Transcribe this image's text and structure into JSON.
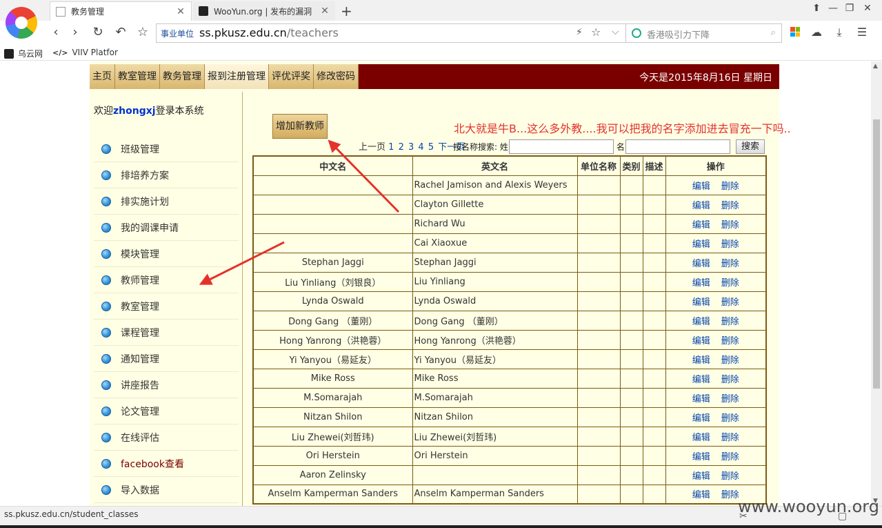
{
  "browser": {
    "tabs": [
      {
        "label": "教务管理",
        "active": true
      },
      {
        "label": "WooYun.org | 发布的漏洞",
        "active": false
      }
    ],
    "new_tab": "+",
    "nav": {
      "back": "‹",
      "forward": "›",
      "reload": "↻",
      "undo": "↶",
      "star": "☆"
    },
    "address": {
      "badge": "事业单位",
      "host": "ss.pkusz.edu.cn",
      "path": "/teachers"
    },
    "search_placeholder": "香港吸引力下降",
    "bookmarks": [
      {
        "label": "乌云网",
        "icon": "wooyun-icon"
      },
      {
        "label": "VIIV Platfor",
        "icon": "code-icon"
      }
    ],
    "status_url": "ss.pkusz.edu.cn/student_classes",
    "watermark": "www.wooyun.org"
  },
  "page": {
    "nav_tabs": [
      "主页",
      "教室管理",
      "教务管理",
      "报到注册管理",
      "评优评奖",
      "修改密码"
    ],
    "active_tab_index": 3,
    "today": "今天是2015年8月16日 星期日",
    "welcome_prefix": "欢迎",
    "welcome_user": "zhongxj",
    "welcome_suffix": "登录本系统",
    "menu": [
      "班级管理",
      "排培养方案",
      "排实施计划",
      "我的调课申请",
      "模块管理",
      "教师管理",
      "教室管理",
      "课程管理",
      "通知管理",
      "讲座报告",
      "论文管理",
      "在线评估",
      "facebook查看",
      "导入数据"
    ],
    "add_teacher_label": "增加新教师",
    "annotation": "北大就是牛B...这么多外教....我可以把我的名字添加进去冒充一下吗..",
    "pager": {
      "prev": "上一页",
      "pages": [
        "1",
        "2",
        "3",
        "4",
        "5"
      ],
      "next": "下一页"
    },
    "search": {
      "prefix": "按名称搜索: 姓",
      "given_label": "名",
      "button": "搜索"
    },
    "table": {
      "headers": [
        "中文名",
        "英文名",
        "单位名称",
        "类别",
        "描述",
        "操作"
      ],
      "edit_label": "编辑",
      "delete_label": "删除",
      "rows": [
        {
          "cn": "",
          "en": "Rachel Jamison and Alexis Weyers"
        },
        {
          "cn": "",
          "en": "Clayton Gillette"
        },
        {
          "cn": "",
          "en": "Richard Wu"
        },
        {
          "cn": "",
          "en": "Cai Xiaoxue"
        },
        {
          "cn": "Stephan Jaggi",
          "en": "Stephan Jaggi"
        },
        {
          "cn": "Liu Yinliang（刘银良）",
          "en": "Liu Yinliang"
        },
        {
          "cn": "Lynda Oswald",
          "en": "Lynda Oswald"
        },
        {
          "cn": "Dong Gang （董刚）",
          "en": "Dong Gang （董刚）"
        },
        {
          "cn": "Hong Yanrong（洪艳蓉）",
          "en": "Hong Yanrong（洪艳蓉）"
        },
        {
          "cn": "Yi Yanyou（易延友）",
          "en": "Yi Yanyou（易延友）"
        },
        {
          "cn": "Mike Ross",
          "en": "Mike Ross"
        },
        {
          "cn": "M.Somarajah",
          "en": "M.Somarajah"
        },
        {
          "cn": "Nitzan Shilon",
          "en": "Nitzan Shilon"
        },
        {
          "cn": "Liu Zhewei(刘哲玮)",
          "en": "Liu Zhewei(刘哲玮)"
        },
        {
          "cn": "Ori Herstein",
          "en": "Ori Herstein"
        },
        {
          "cn": "Aaron Zelinsky",
          "en": ""
        },
        {
          "cn": "Anselm Kamperman Sanders",
          "en": "Anselm Kamperman Sanders"
        }
      ]
    },
    "colors": {
      "nav_bg": "#7a0000",
      "page_bg": "#ffffe5",
      "annotation": "#e4322b",
      "link": "#0645ad"
    }
  }
}
